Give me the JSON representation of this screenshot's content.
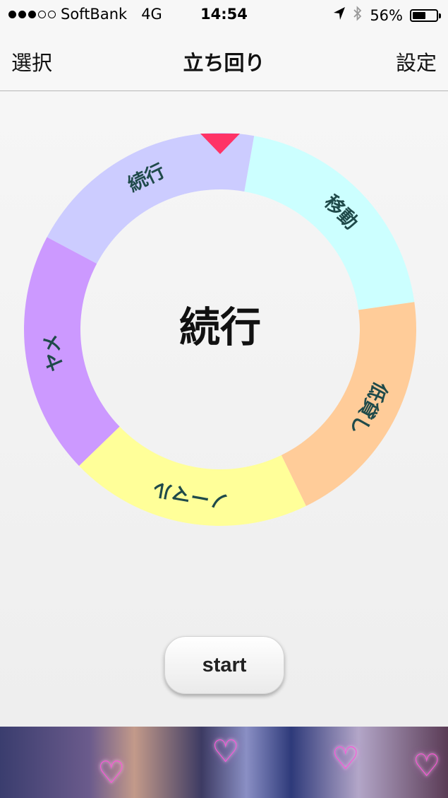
{
  "status_bar": {
    "signal_dots_filled": 3,
    "signal_dots_total": 5,
    "carrier": "SoftBank",
    "network": "4G",
    "time": "14:54",
    "battery_percent": "56%",
    "battery_level": 0.56,
    "icons": [
      "location-arrow-icon",
      "bluetooth-icon",
      "battery-icon"
    ]
  },
  "nav": {
    "left": "選択",
    "title": "立ち回り",
    "right": "設定"
  },
  "wheel": {
    "pointer_color": "#ff3366",
    "center_label": "続行",
    "segments": [
      {
        "label": "続行",
        "color": "#ccccff"
      },
      {
        "label": "移動",
        "color": "#ccffff"
      },
      {
        "label": "低貸し",
        "color": "#ffcc99"
      },
      {
        "label": "ノーマル",
        "color": "#ffff99"
      },
      {
        "label": "ヤメ",
        "color": "#cc99ff"
      }
    ]
  },
  "start_label": "start",
  "ad_banner": {
    "icons": [
      "heart-icon",
      "heart-icon",
      "heart-icon",
      "heart-icon"
    ]
  }
}
